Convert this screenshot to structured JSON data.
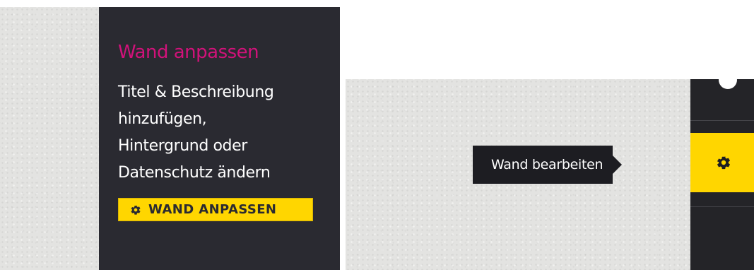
{
  "left_panel": {
    "title": "Wand anpassen",
    "description_lines": [
      "Titel & Beschreibung",
      "hinzufügen,",
      "Hintergrund oder",
      "Datenschutz ändern"
    ],
    "customize_button_label": "WAND ANPASSEN",
    "customize_button_icon": "gear-icon"
  },
  "right_panel": {
    "tooltip_text": "Wand bearbeiten",
    "edit_button_icon": "gear-icon"
  },
  "colors": {
    "card_background": "#2a2a31",
    "title_magenta": "#d1127a",
    "accent_yellow": "#ffd600",
    "tooltip_background": "#1d1d22",
    "paper_background": "#e3e3e1"
  }
}
